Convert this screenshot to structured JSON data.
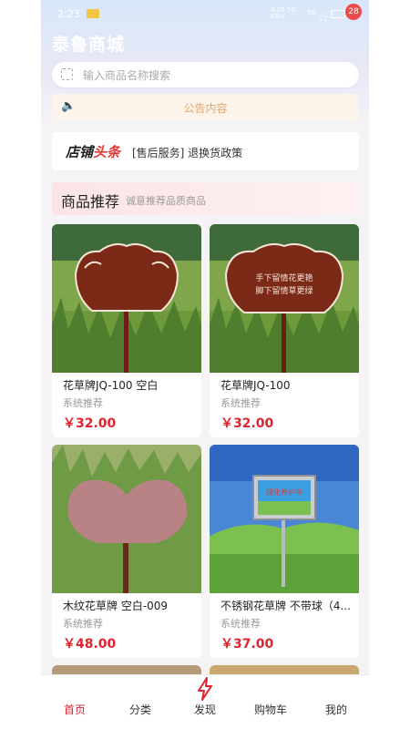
{
  "status": {
    "time": "2:23",
    "net_top": "0.00 5G",
    "net_bottom": "KB/s",
    "signal": "5G",
    "badge": "28"
  },
  "header": {
    "title": "泰鲁商城"
  },
  "search": {
    "placeholder": "输入商品名称搜索"
  },
  "notice": {
    "text": "公告内容"
  },
  "headline": {
    "logo_black": "店铺",
    "logo_red": "头条",
    "tag": "[售后服务] 退换货政策"
  },
  "recommend": {
    "heading": "商品推荐",
    "subheading": "诚意推荐品质商品"
  },
  "products": [
    {
      "name": "花草牌JQ-100 空白",
      "sub": "系统推荐",
      "price": "￥32.00"
    },
    {
      "name": "花草牌JQ-100",
      "sub": "系统推荐",
      "price": "￥32.00",
      "sign_text_1": "手下留情花更艳",
      "sign_text_2": "脚下留情草更绿"
    },
    {
      "name": "木纹花草牌 空白-009",
      "sub": "系统推荐",
      "price": "￥48.00"
    },
    {
      "name": "不锈钢花草牌 不带球（4...",
      "sub": "系统推荐",
      "price": "￥37.00",
      "sign_text": "绿化养护中"
    }
  ],
  "tabbar": [
    "首页",
    "分类",
    "发现",
    "购物车",
    "我的"
  ],
  "colors": {
    "accent": "#e0242f",
    "notice": "#e1a86a"
  }
}
